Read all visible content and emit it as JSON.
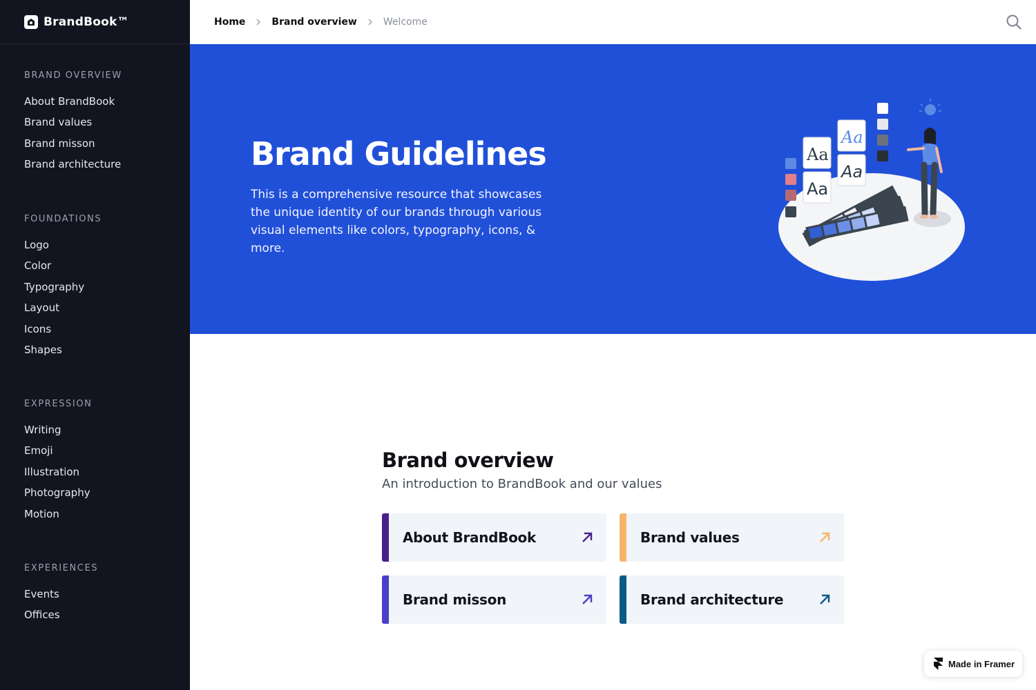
{
  "app": {
    "brand_name": "BrandBook™"
  },
  "sidebar": {
    "sections": [
      {
        "heading": "BRAND OVERVIEW",
        "items": [
          "About BrandBook",
          "Brand values",
          "Brand misson",
          "Brand architecture"
        ]
      },
      {
        "heading": "FOUNDATIONS",
        "items": [
          "Logo",
          "Color",
          "Typography",
          "Layout",
          "Icons",
          "Shapes"
        ]
      },
      {
        "heading": "EXPRESSION",
        "items": [
          "Writing",
          "Emoji",
          "Illustration",
          "Photography",
          "Motion"
        ]
      },
      {
        "heading": "EXPERIENCES",
        "items": [
          "Events",
          "Offices"
        ]
      }
    ]
  },
  "breadcrumb": {
    "home": "Home",
    "section": "Brand overview",
    "current": "Welcome"
  },
  "hero": {
    "title": "Brand Guidelines",
    "description": "This is a comprehensive resource that showcases the unique identity of our brands through various visual elements like colors, typography, icons, & more.",
    "background": "#2150d8"
  },
  "overview": {
    "title": "Brand overview",
    "subtitle": "An introduction to BrandBook and our values",
    "cards": [
      {
        "label": "About BrandBook",
        "accent": "#4a1f8c",
        "icon": "arrow-up-right-icon"
      },
      {
        "label": "Brand values",
        "accent": "#f7b56b",
        "icon": "arrow-up-right-icon"
      },
      {
        "label": "Brand misson",
        "accent": "#4a3fc8",
        "icon": "arrow-up-right-icon"
      },
      {
        "label": "Brand architecture",
        "accent": "#0a5a87",
        "icon": "arrow-up-right-icon"
      }
    ]
  },
  "badge": {
    "label": "Made in Framer"
  }
}
